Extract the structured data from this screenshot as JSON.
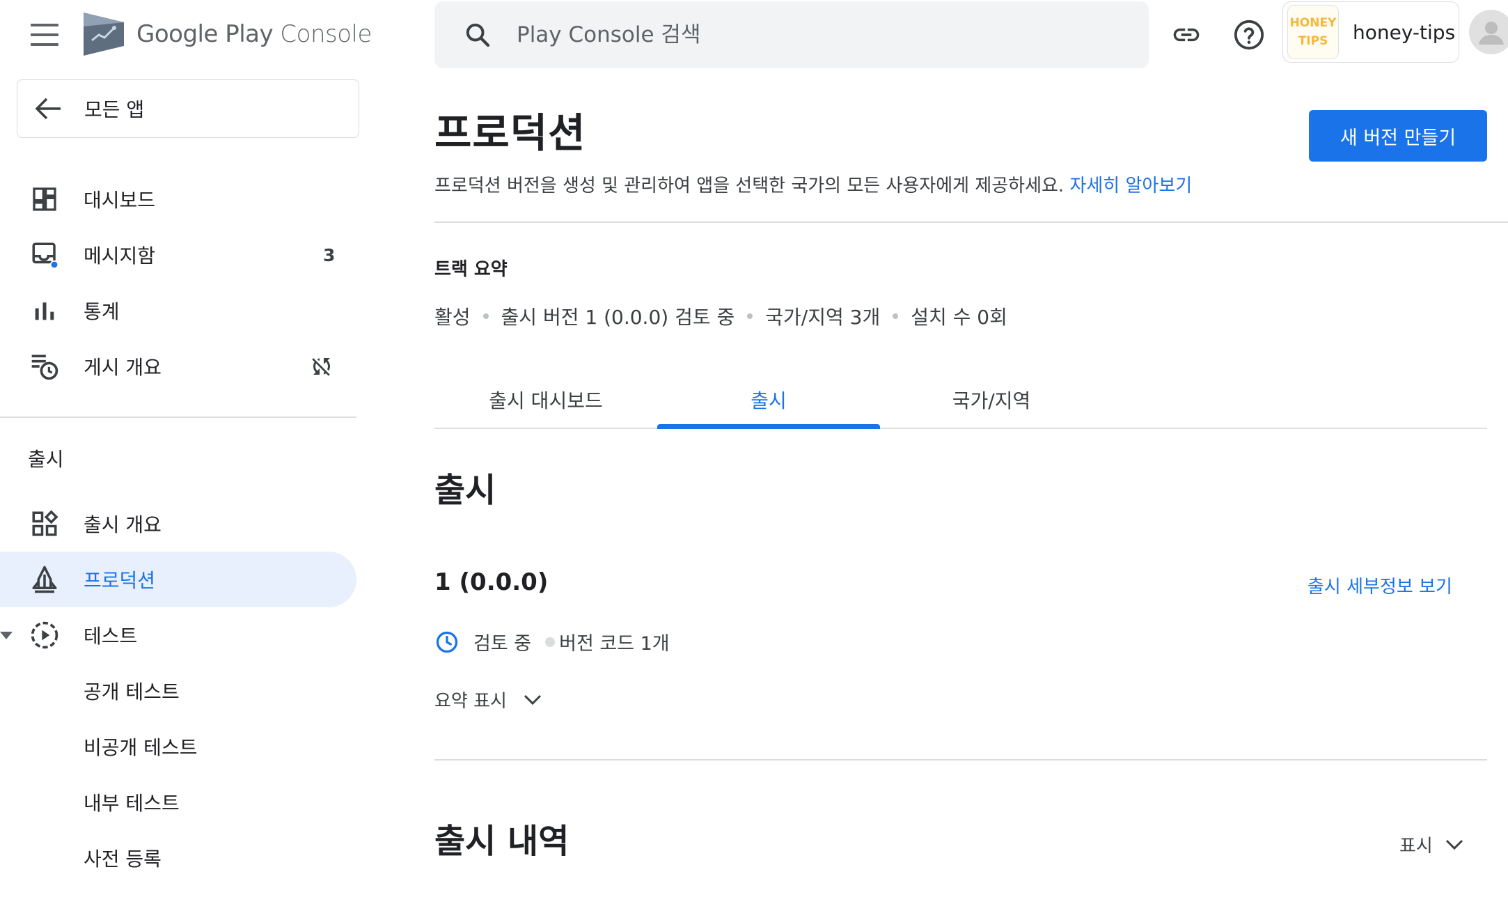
{
  "header": {
    "logo_brand": "Google Play",
    "logo_product": "Console",
    "search_placeholder": "Play Console 검색",
    "account_logo_line1": "HONEY",
    "account_logo_line2": "TIPS",
    "account_name": "honey-tips"
  },
  "sidebar": {
    "back_label": "모든 앱",
    "items": [
      {
        "label": "대시보드",
        "icon": "dashboard-icon"
      },
      {
        "label": "메시지함",
        "icon": "inbox-icon",
        "badge": "3"
      },
      {
        "label": "통계",
        "icon": "bar-chart-icon"
      },
      {
        "label": "게시 개요",
        "icon": "publishing-overview-icon"
      }
    ],
    "section_release": "출시",
    "release_items": [
      {
        "label": "출시 개요",
        "icon": "release-overview-icon"
      },
      {
        "label": "프로덕션",
        "icon": "production-icon",
        "active": true
      },
      {
        "label": "테스트",
        "icon": "testing-icon"
      },
      {
        "label": "공개 테스트"
      },
      {
        "label": "비공개 테스트"
      },
      {
        "label": "내부 테스트"
      },
      {
        "label": "사전 등록"
      }
    ]
  },
  "main": {
    "title": "프로덕션",
    "new_release_button": "새 버전 만들기",
    "description": "프로덕션 버전을 생성 및 관리하여 앱을 선택한 국가의 모든 사용자에게 제공하세요.",
    "learn_more": "자세히 알아보기",
    "track_summary_title": "트랙 요약",
    "summary": [
      "활성",
      "출시 버전 1 (0.0.0) 검토 중",
      "국가/지역 3개",
      "설치 수 0회"
    ],
    "tabs": [
      "출시 대시보드",
      "출시",
      "국가/지역"
    ],
    "active_tab_index": 1,
    "releases_heading": "출시",
    "release": {
      "name": "1 (0.0.0)",
      "details_link": "출시 세부정보 보기",
      "status": "검토 중",
      "version_codes": "버전 코드 1개",
      "expand_label": "요약 표시"
    },
    "history_heading": "출시 내역",
    "history_toggle": "표시"
  },
  "colors": {
    "accent": "#1a73e8",
    "active_nav_bg": "#e8f0fe",
    "notification_dot": "#1a73e8"
  }
}
